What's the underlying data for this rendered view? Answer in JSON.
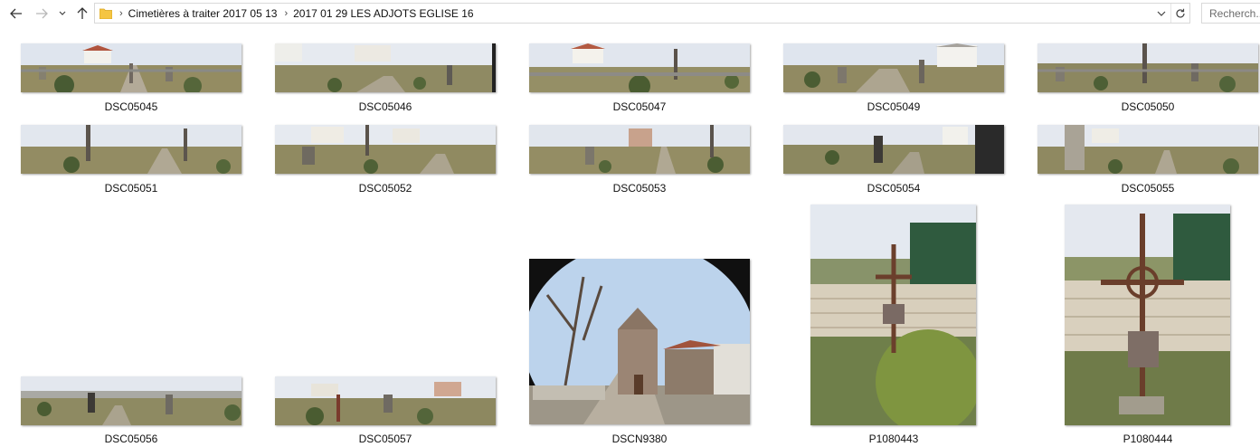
{
  "nav": {
    "back_icon": "arrow-left-icon",
    "forward_icon": "arrow-right-icon",
    "recent_icon": "chevron-down-icon",
    "up_icon": "arrow-up-icon"
  },
  "address": {
    "crumbs": [
      "Cimetières à traiter 2017 05 13",
      "2017 01 29 LES ADJOTS EGLISE 16"
    ],
    "separator": "›"
  },
  "search": {
    "placeholder": "Recherch..."
  },
  "files": [
    {
      "name": "DSC05045"
    },
    {
      "name": "DSC05046"
    },
    {
      "name": "DSC05047"
    },
    {
      "name": "DSC05049"
    },
    {
      "name": "DSC05050"
    },
    {
      "name": "DSC05051"
    },
    {
      "name": "DSC05052"
    },
    {
      "name": "DSC05053"
    },
    {
      "name": "DSC05054"
    },
    {
      "name": "DSC05055"
    },
    {
      "name": "DSC05056"
    },
    {
      "name": "DSC05057"
    },
    {
      "name": "DSCN9380"
    },
    {
      "name": "P1080443"
    },
    {
      "name": "P1080444"
    }
  ],
  "colors": {
    "folder": "#f5c542",
    "sky": "#e3e8ef",
    "grass": "#8e8a5a",
    "shrub": "#4f5e35"
  }
}
